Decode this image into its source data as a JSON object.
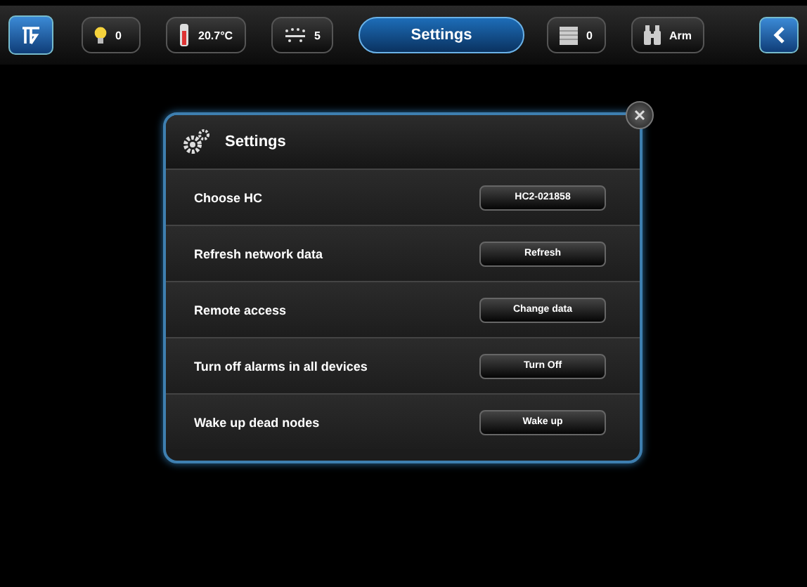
{
  "toolbar": [
    {
      "kind": "logo"
    },
    {
      "kind": "bulb",
      "value": "0"
    },
    {
      "kind": "thermometer",
      "value": "20.7°C"
    },
    {
      "kind": "sprinkler",
      "value": "5"
    },
    {
      "kind": "tab",
      "label": "Settings",
      "selected": true
    },
    {
      "kind": "blind",
      "value": "0"
    },
    {
      "kind": "alarm",
      "value": "Arm"
    },
    {
      "kind": "back"
    }
  ],
  "dialog": {
    "title": "Settings",
    "rows": [
      {
        "label": "Choose HC",
        "button": "HC2-021858"
      },
      {
        "label": "Refresh network data",
        "button": "Refresh"
      },
      {
        "label": "Remote access",
        "button": "Change data"
      },
      {
        "label": "Turn off alarms in all devices",
        "button": "Turn Off"
      },
      {
        "label": "Wake up dead nodes",
        "button": "Wake up"
      }
    ]
  }
}
